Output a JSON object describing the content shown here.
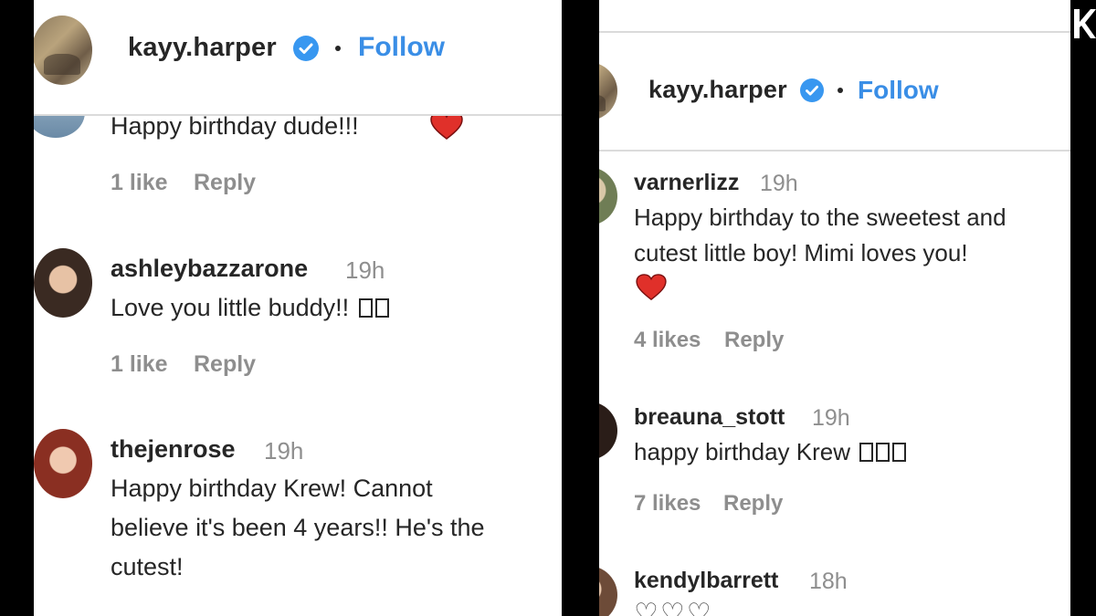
{
  "left": {
    "header": {
      "username": "kayy.harper",
      "follow_label": "Follow"
    },
    "partial_comment": {
      "text": "Happy birthday dude!!!",
      "likes": "1 like",
      "reply": "Reply"
    },
    "comments": [
      {
        "username": "ashleybazzarone",
        "time": "19h",
        "text": "Love you little buddy!!",
        "likes": "1 like",
        "reply": "Reply"
      },
      {
        "username": "thejenrose",
        "time": "19h",
        "lines": [
          "Happy birthday Krew! Cannot",
          "believe it's been 4 years!! He's the",
          "cutest!"
        ]
      }
    ]
  },
  "right": {
    "header": {
      "username": "kayy.harper",
      "follow_label": "Follow"
    },
    "comments": [
      {
        "username": "varnerlizz",
        "time": "19h",
        "lines": [
          "Happy birthday to the sweetest and",
          "cutest little boy! Mimi loves you!"
        ],
        "likes": "4 likes",
        "reply": "Reply"
      },
      {
        "username": "breauna_stott",
        "time": "19h",
        "text": "happy birthday Krew",
        "likes": "7 likes",
        "reply": "Reply"
      },
      {
        "username": "kendylbarrett",
        "time": "18h"
      }
    ]
  },
  "colors": {
    "link": "#3a8ee6",
    "verified": "#3897f0",
    "heart": "#e0302a",
    "muted": "#8e8e8e",
    "text": "#262626"
  },
  "icons": [
    "verified-badge-icon",
    "red-heart-emoji-icon",
    "outline-heart-emoji-icon"
  ]
}
